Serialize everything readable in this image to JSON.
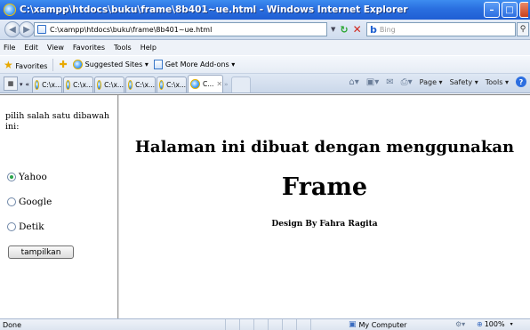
{
  "window": {
    "title": "C:\\xampp\\htdocs\\buku\\frame\\8b401~ue.html - Windows Internet Explorer",
    "minimize": "–",
    "maximize": "□"
  },
  "address": {
    "url": "C:\\xampp\\htdocs\\buku\\frame\\8b401~ue.html",
    "search_placeholder": "Bing",
    "search_brand": "b"
  },
  "menu": [
    "File",
    "Edit",
    "View",
    "Favorites",
    "Tools",
    "Help"
  ],
  "favorites_bar": {
    "favorites_label": "Favorites",
    "suggested_sites": "Suggested Sites ▾",
    "addons": "Get More Add-ons ▾"
  },
  "tabs": {
    "items": [
      "C:\\x...",
      "C:\\x...",
      "C:\\x...",
      "C:\\x...",
      "C:\\x...",
      "C..."
    ],
    "active_index": 5
  },
  "command_bar": {
    "page": "Page ▾",
    "safety": "Safety ▾",
    "tools": "Tools ▾"
  },
  "left_frame": {
    "intro": "pilih salah satu dibawah ini:",
    "options": [
      {
        "label": "Yahoo",
        "selected": true
      },
      {
        "label": "Google",
        "selected": false
      },
      {
        "label": "Detik",
        "selected": false
      }
    ],
    "submit_label": "tampilkan"
  },
  "main_frame": {
    "heading": "Halaman ini dibuat dengan menggunakan",
    "title": "Frame",
    "credit": "Design By Fahra Ragita"
  },
  "status": {
    "text": "Done",
    "zone": "My Computer",
    "zoom": "100%"
  },
  "colors": {
    "titlebar": "#2a6fe0",
    "radio_selected": "#2aa44a"
  }
}
